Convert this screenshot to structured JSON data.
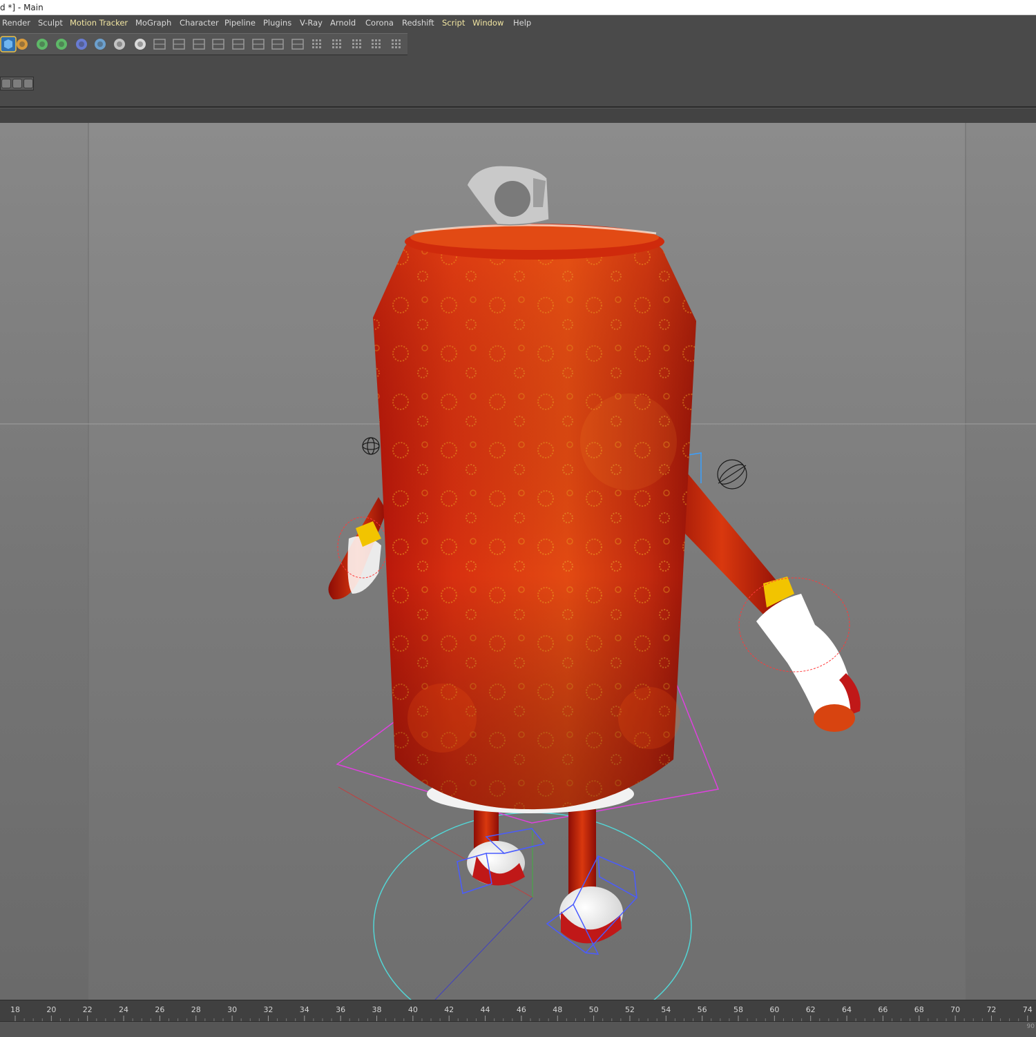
{
  "window": {
    "title": "d *] - Main"
  },
  "menu": {
    "items": [
      {
        "label": "Render"
      },
      {
        "label": "Sculpt"
      },
      {
        "label": "Motion Tracker",
        "highlighted": true
      },
      {
        "label": "MoGraph"
      },
      {
        "label": "Character"
      },
      {
        "label": "Pipeline"
      },
      {
        "label": "Plugins"
      },
      {
        "label": "V-Ray"
      },
      {
        "label": "Arnold"
      },
      {
        "label": "Corona"
      },
      {
        "label": "Redshift"
      },
      {
        "label": "Script",
        "highlighted": true
      },
      {
        "label": "Window",
        "highlighted": true
      },
      {
        "label": "Help"
      }
    ]
  },
  "toolbar": {
    "icons": [
      "cube-primitive-icon",
      "pen-spline-icon",
      "subdivision-generator-icon",
      "cloner-icon",
      "deformer-icon",
      "floor-environment-icon",
      "camera-icon",
      "light-icon",
      "align-tool-icon",
      "mirror-tool-icon",
      "polygon-tool-icon",
      "bevel-tool-icon",
      "knife-tool-icon",
      "bridge-tool-icon",
      "extrude-tool-icon",
      "inner-extrude-icon",
      "snap-grid-icon",
      "axis-workplane-icon",
      "points-mode-icon",
      "edges-mode-icon",
      "polygons-mode-icon"
    ],
    "subtool_icons": [
      "model-mode-icon",
      "texture-mode-icon",
      "uv-mode-icon"
    ]
  },
  "viewport": {
    "background": "#777777",
    "scene": "soda-can-character-rig",
    "can_color": "#c8200a"
  },
  "timeline": {
    "ticks": [
      "18",
      "20",
      "22",
      "24",
      "26",
      "28",
      "30",
      "32",
      "34",
      "36",
      "38",
      "40",
      "42",
      "44",
      "46",
      "48",
      "50",
      "52",
      "54",
      "56",
      "58",
      "60",
      "62",
      "64",
      "66",
      "68",
      "70",
      "72",
      "74"
    ],
    "end_frame": "90"
  }
}
